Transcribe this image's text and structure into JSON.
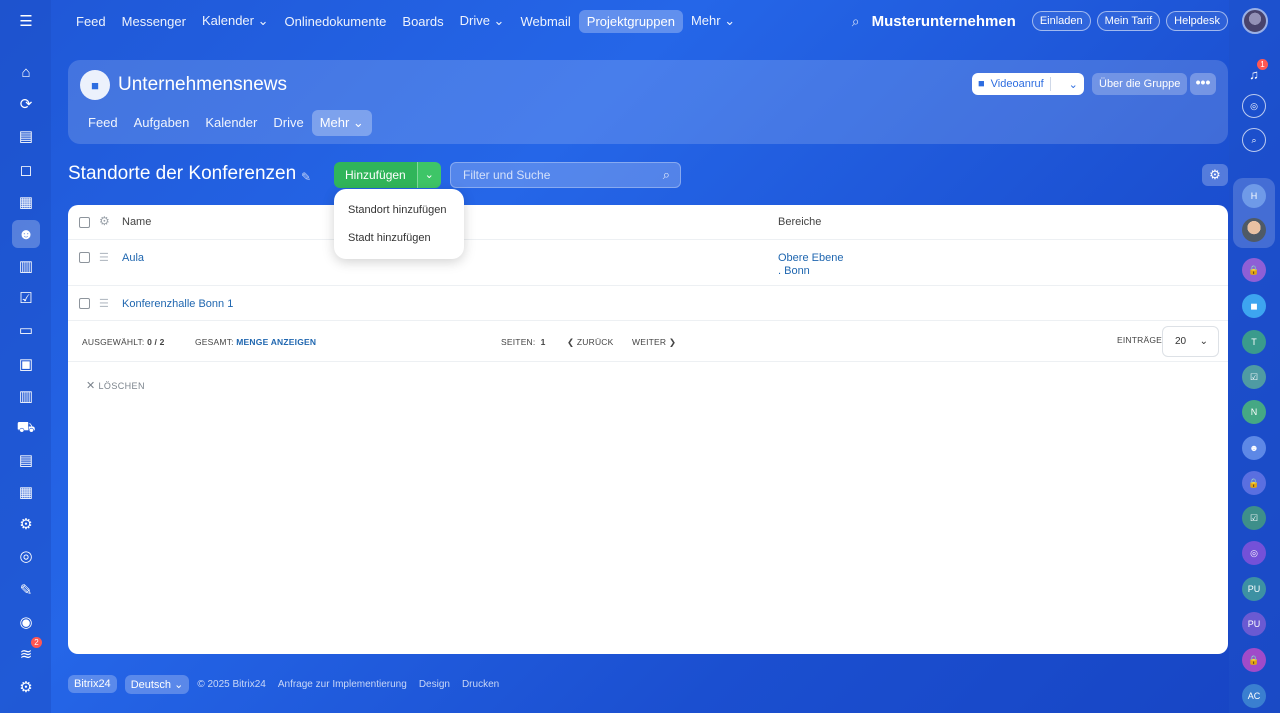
{
  "topnav": {
    "items": [
      {
        "label": "Feed"
      },
      {
        "label": "Messenger"
      },
      {
        "label": "Kalender ⌄"
      },
      {
        "label": "Onlinedokumente"
      },
      {
        "label": "Boards"
      },
      {
        "label": "Drive ⌄"
      },
      {
        "label": "Webmail"
      },
      {
        "label": "Projektgruppen"
      },
      {
        "label": "Mehr ⌄"
      }
    ],
    "active": "Projektgruppen",
    "company": "Musterunternehmen",
    "invite": "Einladen",
    "plan": "Mein Tarif",
    "helpdesk": "Helpdesk"
  },
  "group": {
    "title": "Unternehmensnews",
    "tabs": [
      "Feed",
      "Aufgaben",
      "Kalender",
      "Drive",
      "Mehr ⌄"
    ],
    "active_tab": "Mehr ⌄",
    "video_label": "Videoanruf",
    "about_label": "Über die Gruppe",
    "more_label": "•••"
  },
  "page": {
    "title": "Standorte der Konferenzen",
    "add_label": "Hinzufügen",
    "search_placeholder": "Filter und Suche"
  },
  "dropdown": {
    "items": [
      "Standort hinzufügen",
      "Stadt hinzufügen"
    ]
  },
  "table": {
    "columns": {
      "name": "Name",
      "area": "Bereiche"
    },
    "rows": [
      {
        "name": "Aula",
        "area_line1": "Obere Ebene",
        "area_line2": ". Bonn"
      },
      {
        "name": "Konferenzhalle Bonn 1",
        "area_line1": "",
        "area_line2": ""
      }
    ],
    "footer": {
      "selected_label": "Ausgewählt:",
      "selected_value": "0 / 2",
      "total_label": "Gesamt:",
      "total_link": "Menge anzeigen",
      "pages_label": "Seiten:",
      "page_value": "1",
      "prev_label": "❮ Zurück",
      "next_label": "Weiter ❯",
      "per_page_label": "Einträge",
      "per_page_value": "20"
    },
    "delete_label": "Löschen"
  },
  "right_bar": {
    "notification_count": "1",
    "avatars": [
      "H",
      "T",
      "N",
      "PU",
      "PU",
      "AC"
    ]
  },
  "left_bar": {
    "badge": "2"
  },
  "footer": {
    "brand": "Bitrix24",
    "language": "Deutsch",
    "copyright": "© 2025 Bitrix24",
    "links": [
      "Anfrage zur Implementierung",
      "Design",
      "Drucken"
    ]
  },
  "colors": {
    "accent": "#2067b0",
    "add_button": "#30b55a",
    "background": "#1f57d6"
  }
}
